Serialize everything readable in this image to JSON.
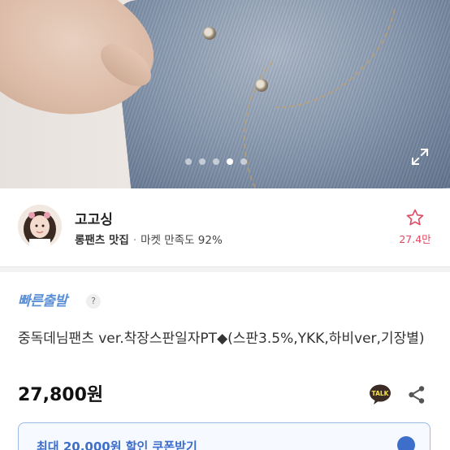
{
  "gallery": {
    "total_images": 5,
    "active_index": 3
  },
  "seller": {
    "name": "고고싱",
    "tag": "롱팬츠 맛집",
    "market_label": "마켓 만족도 92%",
    "like_count": "27.4만"
  },
  "product": {
    "badge": "빠른출발",
    "help_glyph": "?",
    "title": "중독데님팬츠 ver.착장스판일자PT◆(스판3.5%,YKK,하비ver,기장별)",
    "price": "27,800원",
    "coupon": "최대 20,000원 할인 쿠폰받기"
  },
  "colors": {
    "accent_blue": "#3d6ec9",
    "like_red": "#e04a62"
  },
  "icons": {
    "expand": "expand-icon",
    "like": "star-icon",
    "kakao": "kakaotalk-icon",
    "share": "share-icon",
    "coupon": "download-icon"
  }
}
